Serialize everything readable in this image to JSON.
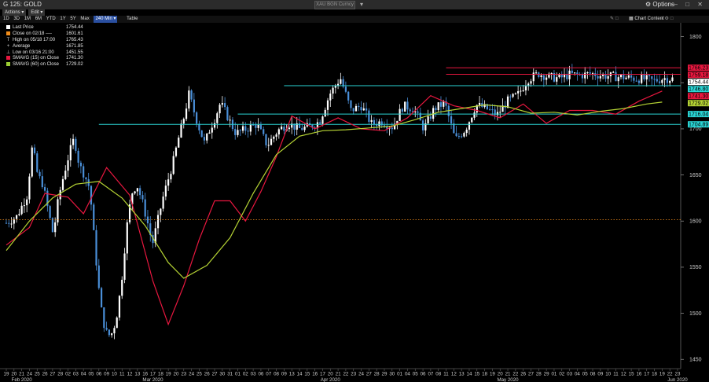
{
  "window": {
    "title": "G 125: GOLD",
    "search_placeholder": "XAU BGN Curncy",
    "options_label": "Options",
    "window_controls": "— □ ✕"
  },
  "menu": {
    "items": [
      "Actions ▾",
      "Edit ▾"
    ]
  },
  "toolbar": {
    "ranges": [
      "1D",
      "3D",
      "1M",
      "6M",
      "YTD",
      "1Y",
      "5Y",
      "Max",
      "240 Min ▾"
    ],
    "active_range": "240 Min ▾",
    "table_label": "Table",
    "chart_content_label": "Chart Content"
  },
  "legend": [
    {
      "label": "Last Price",
      "value": "1754.44",
      "color": "#ffffff",
      "glyph": "square"
    },
    {
      "label": "Close on 02/18 ----",
      "value": "1601.61",
      "color": "#f08c1a",
      "glyph": "square"
    },
    {
      "label": "High on 05/18 17:00",
      "value": "1765.43",
      "glyph": "T"
    },
    {
      "label": "Average",
      "value": "1671.85",
      "glyph": "+"
    },
    {
      "label": "Low on 03/16 21:00",
      "value": "1451.55",
      "glyph": "⊥"
    },
    {
      "label": "SMAVG (15)  on Close",
      "value": "1741.30",
      "color": "#e8173f",
      "glyph": "square"
    },
    {
      "label": "SMAVG (60)  on Close",
      "value": "1729.02",
      "color": "#9acd32",
      "glyph": "square"
    }
  ],
  "colors": {
    "background": "#000000",
    "candle_up": "#ffffff",
    "candle_down": "#4a8fd8",
    "sma15": "#e8173f",
    "sma60": "#b5d334",
    "previous_close": "#f08c1a",
    "resistance_red": "#e8173f",
    "support_cyan": "#2ad4d4"
  },
  "chart_data": {
    "type": "candlestick",
    "instrument": "G 125: GOLD",
    "interval": "240 Min",
    "ylim": [
      1440,
      1815
    ],
    "y_ticks": [
      1450,
      1500,
      1550,
      1600,
      1650,
      1700,
      1750,
      1800
    ],
    "x_tick_labels": [
      "19",
      "20",
      "21",
      "24",
      "25",
      "26",
      "27",
      "28",
      "02",
      "03",
      "04",
      "05",
      "06",
      "09",
      "10",
      "11",
      "12",
      "13",
      "16",
      "17",
      "18",
      "19",
      "20",
      "23",
      "24",
      "25",
      "26",
      "27",
      "30",
      "31",
      "01",
      "02",
      "03",
      "06",
      "07",
      "08",
      "09",
      "13",
      "14",
      "15",
      "16",
      "17",
      "20",
      "21",
      "22",
      "23",
      "24",
      "27",
      "28",
      "29",
      "30",
      "01",
      "04",
      "05",
      "06",
      "07",
      "08",
      "11",
      "12",
      "13",
      "14",
      "15",
      "18",
      "19",
      "20",
      "21",
      "22",
      "26",
      "27",
      "28",
      "29",
      "01",
      "02",
      "03",
      "04",
      "05",
      "08",
      "09",
      "10",
      "11",
      "12",
      "15",
      "16",
      "17",
      "18",
      "19",
      "22",
      "23"
    ],
    "month_labels": [
      "Feb 2020",
      "Mar 2020",
      "Apr 2020",
      "May 2020",
      "Jun 2020"
    ],
    "month_label_indices": [
      2,
      19,
      42,
      65,
      87
    ],
    "price_path": {
      "x_index": [
        0,
        2,
        4,
        5,
        6,
        7,
        8,
        9,
        10,
        11,
        12,
        13,
        14,
        15,
        16,
        17,
        18,
        19,
        20,
        21,
        22,
        23,
        24,
        25,
        26,
        27,
        28,
        30,
        32,
        33,
        34,
        35,
        36,
        37,
        38,
        39,
        40,
        41,
        42,
        43,
        44,
        46,
        48,
        50,
        52,
        54,
        56,
        58,
        60,
        62,
        64,
        65,
        66,
        68,
        70,
        72,
        74,
        76,
        78,
        80,
        82,
        84,
        86,
        88,
        90,
        92,
        94,
        96,
        98,
        100,
        102,
        104,
        106,
        108,
        110,
        112,
        114,
        116,
        118,
        120,
        122,
        124,
        126,
        128
      ],
      "close": [
        1598,
        1605,
        1628,
        1682,
        1650,
        1640,
        1612,
        1585,
        1625,
        1650,
        1672,
        1690,
        1660,
        1650,
        1635,
        1570,
        1510,
        1480,
        1475,
        1492,
        1530,
        1590,
        1630,
        1640,
        1622,
        1600,
        1575,
        1625,
        1665,
        1690,
        1712,
        1738,
        1718,
        1700,
        1684,
        1700,
        1712,
        1728,
        1718,
        1706,
        1695,
        1700,
        1705,
        1682,
        1698,
        1706,
        1700,
        1702,
        1708,
        1738,
        1755,
        1738,
        1720,
        1725,
        1705,
        1708,
        1702,
        1725,
        1722,
        1700,
        1722,
        1728,
        1688,
        1700,
        1726,
        1722,
        1715,
        1730,
        1737,
        1754,
        1760,
        1756,
        1755,
        1759,
        1758,
        1760,
        1758,
        1757,
        1756,
        1755,
        1754,
        1752,
        1755,
        1754
      ]
    },
    "series": [
      {
        "name": "Last Price",
        "kind": "candles",
        "last": 1754.44
      },
      {
        "name": "SMAVG (15)  on Close",
        "kind": "line",
        "last": 1741.3,
        "points": [
          [
            0,
            1574
          ],
          [
            3,
            1593
          ],
          [
            5,
            1630
          ],
          [
            8,
            1626
          ],
          [
            10,
            1608
          ],
          [
            13,
            1658
          ],
          [
            16,
            1628
          ],
          [
            19,
            1535
          ],
          [
            21,
            1488
          ],
          [
            23,
            1530
          ],
          [
            25,
            1580
          ],
          [
            27,
            1622
          ],
          [
            29,
            1622
          ],
          [
            31,
            1600
          ],
          [
            33,
            1632
          ],
          [
            35,
            1670
          ],
          [
            37,
            1714
          ],
          [
            40,
            1700
          ],
          [
            43,
            1712
          ],
          [
            46,
            1700
          ],
          [
            49,
            1698
          ],
          [
            52,
            1712
          ],
          [
            55,
            1736
          ],
          [
            58,
            1725
          ],
          [
            61,
            1720
          ],
          [
            64,
            1712
          ],
          [
            67,
            1727
          ],
          [
            70,
            1706
          ],
          [
            73,
            1720
          ],
          [
            76,
            1720
          ],
          [
            79,
            1716
          ],
          [
            82,
            1730
          ],
          [
            85,
            1741
          ]
        ]
      },
      {
        "name": "SMAVG (60)  on Close",
        "kind": "line",
        "last": 1729.02,
        "points": [
          [
            0,
            1568
          ],
          [
            3,
            1600
          ],
          [
            6,
            1625
          ],
          [
            9,
            1640
          ],
          [
            12,
            1643
          ],
          [
            15,
            1625
          ],
          [
            18,
            1595
          ],
          [
            21,
            1555
          ],
          [
            23,
            1538
          ],
          [
            26,
            1552
          ],
          [
            29,
            1582
          ],
          [
            32,
            1630
          ],
          [
            35,
            1672
          ],
          [
            38,
            1692
          ],
          [
            41,
            1698
          ],
          [
            44,
            1699
          ],
          [
            47,
            1701
          ],
          [
            50,
            1703
          ],
          [
            53,
            1710
          ],
          [
            56,
            1718
          ],
          [
            59,
            1722
          ],
          [
            62,
            1726
          ],
          [
            65,
            1724
          ],
          [
            68,
            1717
          ],
          [
            71,
            1718
          ],
          [
            74,
            1715
          ],
          [
            77,
            1719
          ],
          [
            80,
            1722
          ],
          [
            83,
            1727
          ],
          [
            85,
            1729
          ]
        ]
      }
    ],
    "reference_lines": [
      {
        "label": "Previous close",
        "value": 1601.61,
        "style": "dotted",
        "color": "#f08c1a"
      },
      {
        "label": "",
        "value": 1766.23,
        "color": "#e8173f",
        "start_index": 57
      },
      {
        "label": "",
        "value": 1759.18,
        "color": "#e8173f",
        "start_index": 57
      },
      {
        "label": "",
        "value": 1746.8,
        "color": "#2ad4d4",
        "start_index": 36
      },
      {
        "label": "",
        "value": 1716.04,
        "color": "#2ad4d4",
        "start_index": 30
      },
      {
        "label": "",
        "value": 1704.89,
        "color": "#2ad4d4",
        "start_index": 12
      }
    ],
    "price_tags": [
      {
        "value": "1766.23",
        "bg": "#e8173f",
        "fg": "#000000",
        "level": 1766.23
      },
      {
        "value": "1759.18",
        "bg": "#e8173f",
        "fg": "#000000",
        "level": 1759.18
      },
      {
        "value": "1754.44",
        "bg": "#ffffff",
        "fg": "#000000",
        "level": 1754.44
      },
      {
        "value": "1746.80",
        "bg": "#2ad4d4",
        "fg": "#000000",
        "level": 1746.8
      },
      {
        "value": "1741.30",
        "bg": "#e8173f",
        "fg": "#000000",
        "level": 1741.3
      },
      {
        "value": "1729.02",
        "bg": "#b5d334",
        "fg": "#000000",
        "level": 1729.02
      },
      {
        "value": "1716.04",
        "bg": "#2ad4d4",
        "fg": "#000000",
        "level": 1716.04
      },
      {
        "value": "1704.89",
        "bg": "#2ad4d4",
        "fg": "#000000",
        "level": 1704.89
      }
    ]
  }
}
